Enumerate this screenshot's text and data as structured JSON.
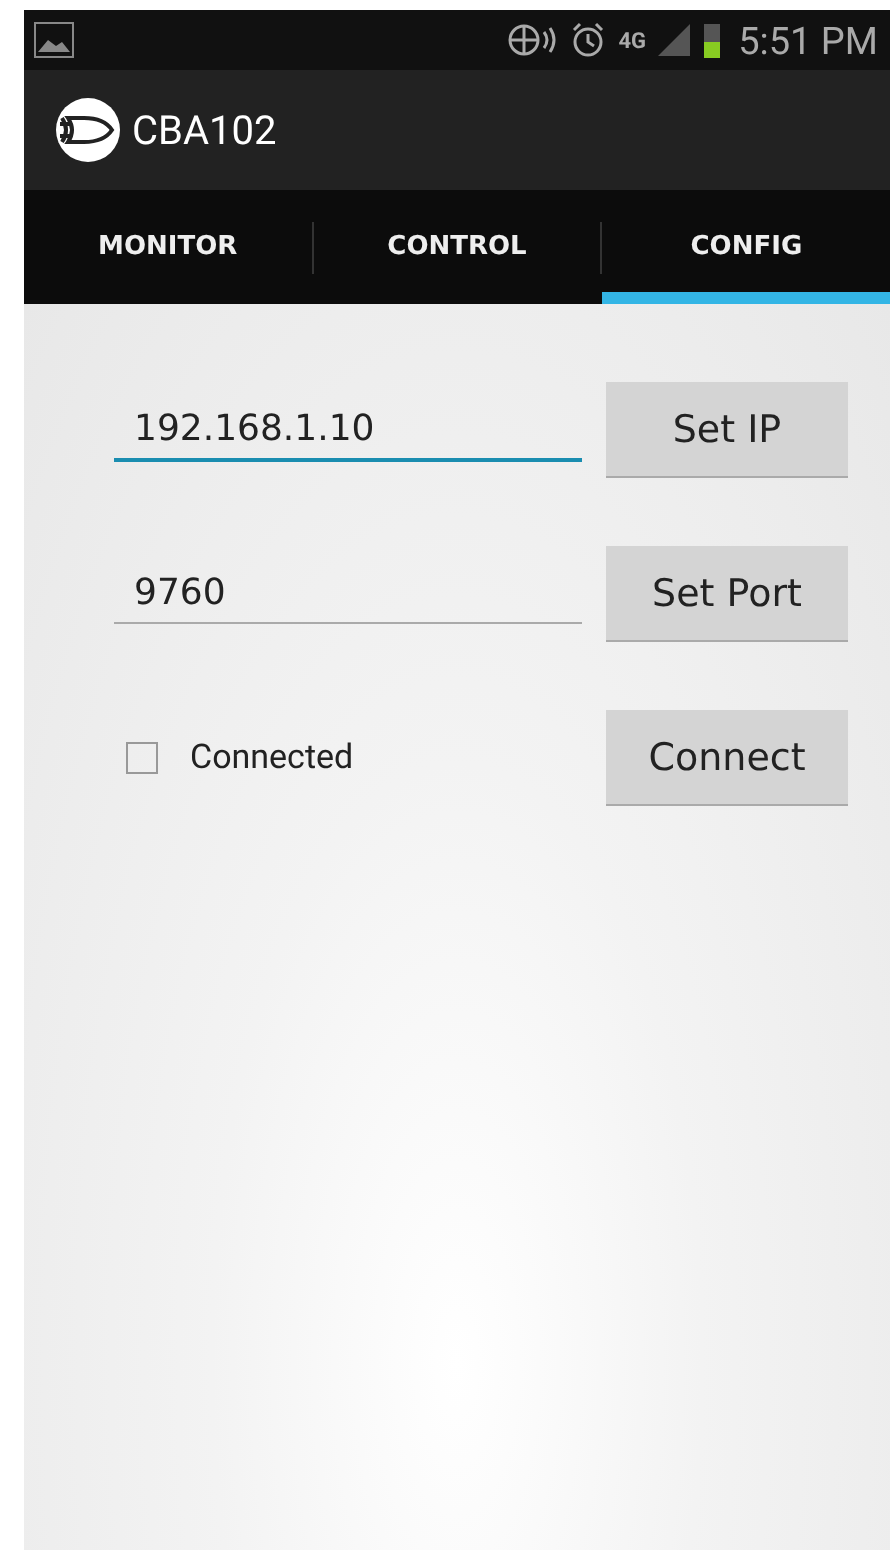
{
  "status_bar": {
    "time": "5:51 PM",
    "network": "4G"
  },
  "app_bar": {
    "title": "CBA102"
  },
  "tabs": [
    {
      "label": "MONITOR",
      "selected": false
    },
    {
      "label": "CONTROL",
      "selected": false
    },
    {
      "label": "CONFIG",
      "selected": true
    }
  ],
  "rows": [
    {
      "kind": "field",
      "value": "192.168.1.10",
      "focused": true,
      "button": "Set IP"
    },
    {
      "kind": "field",
      "value": "9760",
      "focused": false,
      "button": "Set Port"
    },
    {
      "kind": "checkbox",
      "label": "Connected",
      "checked": false,
      "button": "Connect"
    }
  ]
}
